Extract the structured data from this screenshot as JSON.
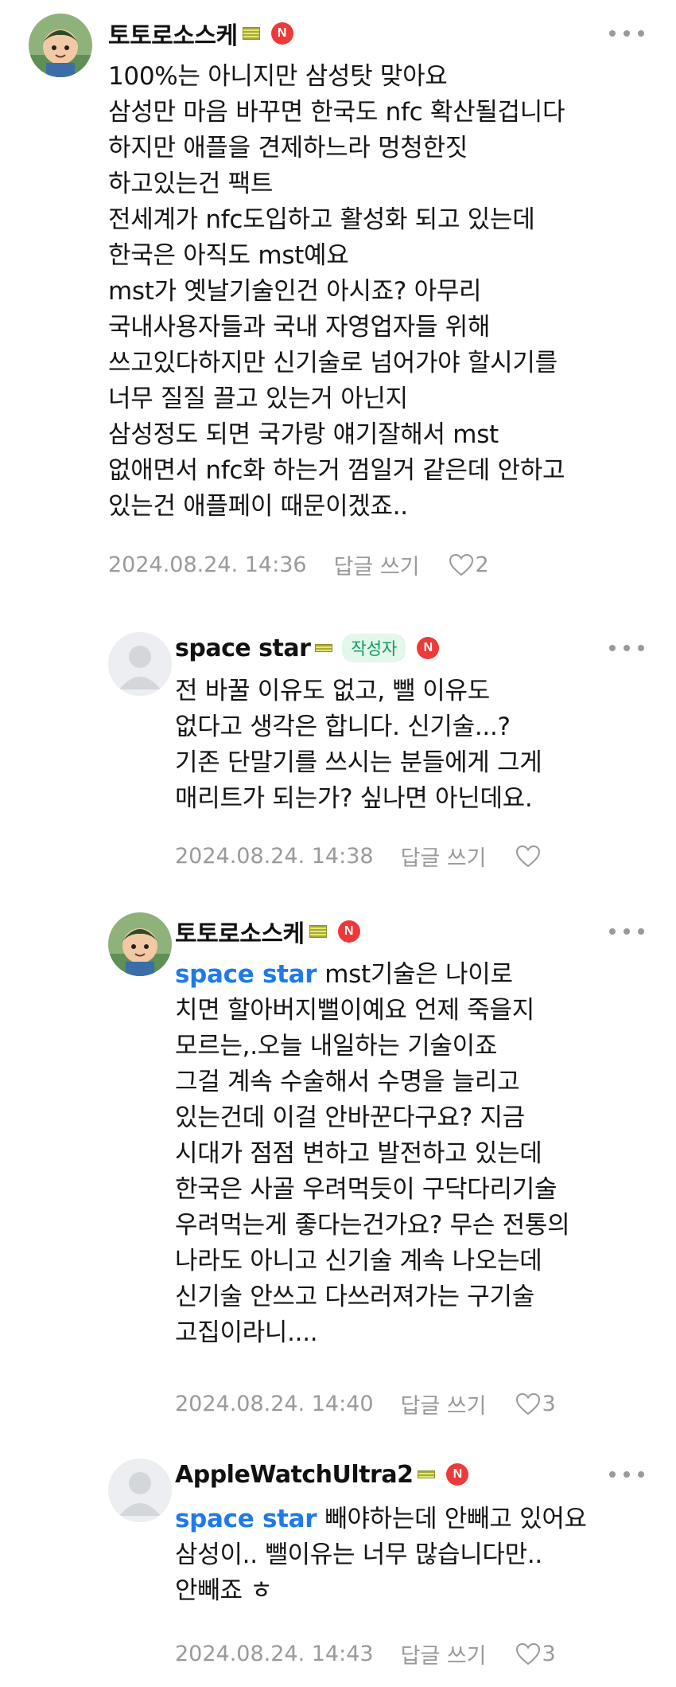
{
  "comments": [
    {
      "author": "토토로소스케",
      "avatar": "character-avatar",
      "badge": "N",
      "body": [
        "100%는 아니지만 삼성탓 맞아요",
        "삼성만 마음 바꾸면 한국도 nfc 확산될겁니다",
        "하지만 애플을 견제하느라 멍청한짓",
        "하고있는건 팩트",
        "전세계가 nfc도입하고 활성화 되고 있는데",
        "한국은 아직도 mst예요",
        "mst가 옛날기술인건 아시죠? 아무리",
        "국내사용자들과 국내 자영업자들 위해",
        "쓰고있다하지만 신기술로 넘어가야 할시기를",
        "너무 질질 끌고 있는거 아닌지",
        "삼성정도 되면 국가랑 얘기잘해서 mst",
        "없애면서 nfc화 하는거 껌일거 같은데 안하고",
        "있는건 애플페이 때문이겠죠.."
      ],
      "timestamp": "2024.08.24. 14:36",
      "reply_label": "답글 쓰기",
      "likes": "2"
    },
    {
      "author": "space star",
      "avatar": "default-avatar",
      "writer_tag": "작성자",
      "badge": "N",
      "body": [
        "전 바꿀 이유도 없고, 뺄 이유도",
        "없다고 생각은 합니다. 신기술...?",
        "기존 단말기를 쓰시는 분들에게 그게",
        "매리트가 되는가? 싶나면 아닌데요."
      ],
      "timestamp": "2024.08.24. 14:38",
      "reply_label": "답글 쓰기",
      "likes": ""
    },
    {
      "author": "토토로소스케",
      "avatar": "character-avatar",
      "badge": "N",
      "mention": "space star",
      "body": [
        "mst기술은 나이로",
        "치면 할아버지뻘이예요 언제 죽을지",
        "모르는,.오늘 내일하는 기술이죠",
        "그걸 계속 수술해서 수명을 늘리고",
        "있는건데 이걸 안바꾼다구요? 지금",
        "시대가 점점 변하고 발전하고 있는데",
        "한국은 사골 우려먹듯이 구닥다리기술",
        "우려먹는게 좋다는건가요? 무슨 전통의",
        "나라도 아니고 신기술 계속 나오는데",
        "신기술 안쓰고 다쓰러져가는 구기술",
        "고집이라니...."
      ],
      "timestamp": "2024.08.24. 14:40",
      "reply_label": "답글 쓰기",
      "likes": "3"
    },
    {
      "author": "AppleWatchUltra2",
      "avatar": "default-avatar",
      "badge": "N",
      "mention": "space star",
      "body": [
        "빼야하는데 안빼고 있어요",
        "삼성이.. 뺄이유는 너무 많습니다만..",
        "안빼죠 ㅎ"
      ],
      "timestamp": "2024.08.24. 14:43",
      "reply_label": "답글 쓰기",
      "likes": "3"
    }
  ],
  "colors": {
    "mention": "#1f7ae8",
    "meta": "#9a9a9a",
    "new_badge": "#ec3a3a",
    "writer_tag_text": "#0f9d58",
    "writer_tag_bg": "#e3f7ea"
  }
}
